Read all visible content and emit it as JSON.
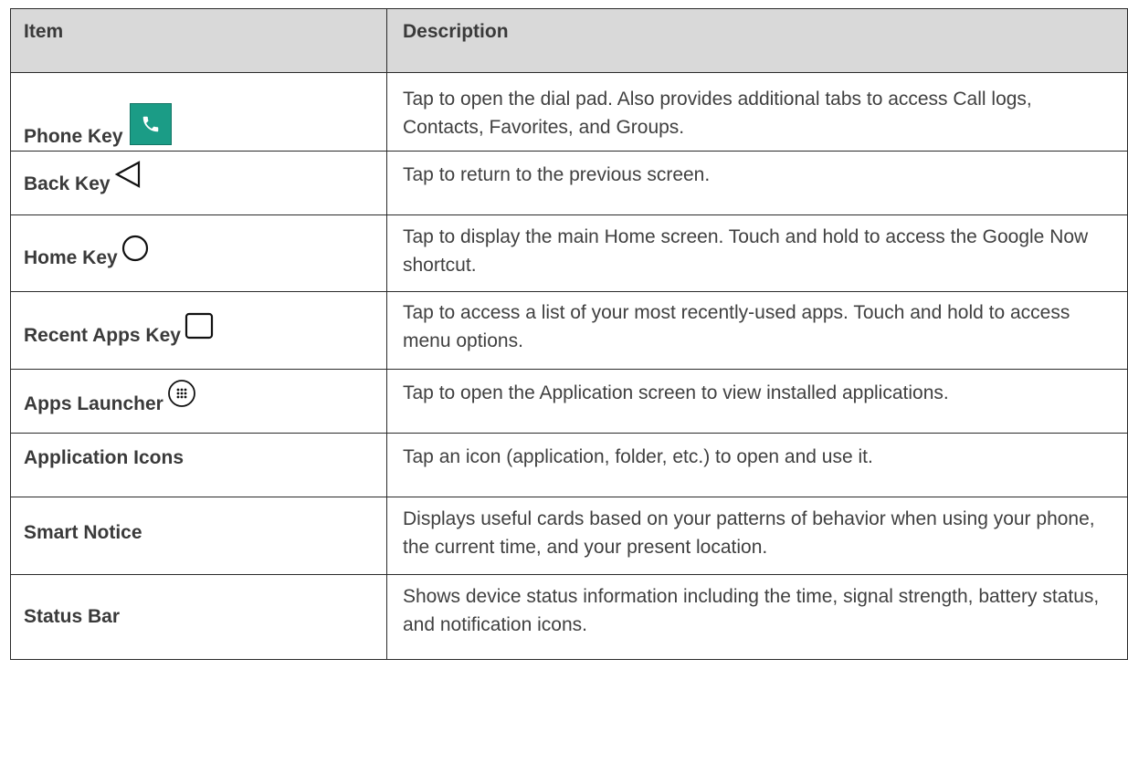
{
  "table": {
    "headers": {
      "item": "Item",
      "description": "Description"
    },
    "rows": [
      {
        "item": "Phone Key",
        "icon": "phone-icon",
        "description": "Tap to open the dial pad. Also provides additional tabs to access Call logs, Contacts, Favorites, and Groups."
      },
      {
        "item": "Back Key",
        "icon": "back-triangle-icon",
        "description": "Tap to return to the previous screen."
      },
      {
        "item": "Home Key",
        "icon": "home-circle-icon",
        "description": "Tap to display the main Home screen. Touch and hold to access the Google Now shortcut."
      },
      {
        "item": "Recent Apps Key",
        "icon": "recent-apps-square-icon",
        "description": "Tap to access a list of your most recently-used apps. Touch and hold to access menu options."
      },
      {
        "item": "Apps Launcher",
        "icon": "apps-launcher-icon",
        "description": "Tap to open the Application screen to view installed applications."
      },
      {
        "item": "Application Icons",
        "description": "Tap an icon (application, folder, etc.) to open and use it."
      },
      {
        "item": "Smart Notice",
        "description": "Displays useful cards based on your patterns of behavior when using your phone, the current time, and your present location."
      },
      {
        "item": "Status Bar",
        "description": "Shows device status information including the time, signal strength, battery status, and notification icons."
      }
    ]
  },
  "colors": {
    "header_background": "#d9d9d9",
    "phone_icon_background": "#1b9c86",
    "border": "#2a2a2a"
  }
}
